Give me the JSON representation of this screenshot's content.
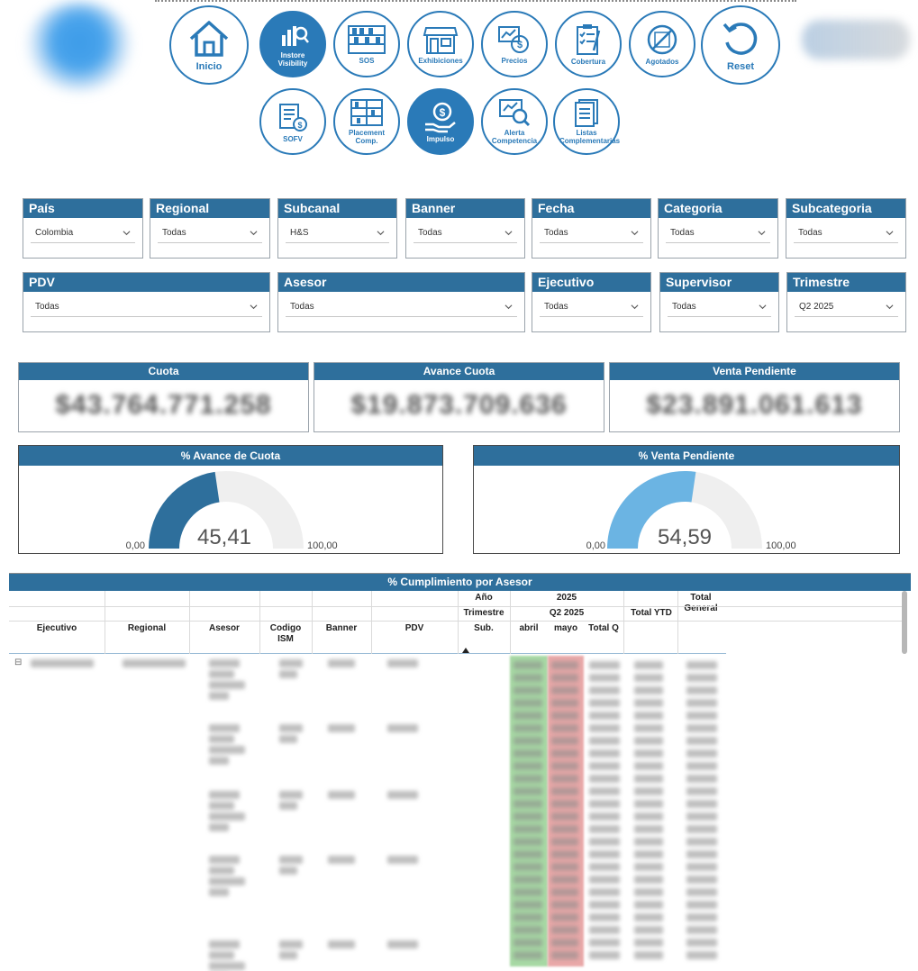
{
  "nav": {
    "row1": [
      {
        "label": "Inicio",
        "icon": "home-icon",
        "active": false
      },
      {
        "label": "Instore Visibility",
        "icon": "analytics-icon",
        "active": true
      },
      {
        "label": "SOS",
        "icon": "shelf-icon",
        "active": false
      },
      {
        "label": "Exhibiciones",
        "icon": "store-icon",
        "active": false
      },
      {
        "label": "Precios",
        "icon": "price-icon",
        "active": false
      },
      {
        "label": "Cobertura",
        "icon": "checklist-icon",
        "active": false
      },
      {
        "label": "Agotados",
        "icon": "out-of-stock-icon",
        "active": false
      },
      {
        "label": "Reset",
        "icon": "reset-icon",
        "active": false
      }
    ],
    "row2": [
      {
        "label": "SOFV",
        "icon": "document-money-icon",
        "active": false
      },
      {
        "label": "Placement Comp.",
        "icon": "shelf-placement-icon",
        "active": false
      },
      {
        "label": "Impulso",
        "icon": "hand-money-icon",
        "active": true
      },
      {
        "label": "Alerta Competencia",
        "icon": "alert-search-icon",
        "active": false
      },
      {
        "label": "Listas Complementarias",
        "icon": "lists-icon",
        "active": false
      }
    ]
  },
  "filters": {
    "pais": {
      "title": "País",
      "value": "Colombia"
    },
    "regional": {
      "title": "Regional",
      "value": "Todas"
    },
    "subcanal": {
      "title": "Subcanal",
      "value": "H&S"
    },
    "banner": {
      "title": "Banner",
      "value": "Todas"
    },
    "fecha": {
      "title": "Fecha",
      "value": "Todas"
    },
    "categoria": {
      "title": "Categoria",
      "value": "Todas"
    },
    "subcategoria": {
      "title": "Subcategoria",
      "value": "Todas"
    },
    "pdv": {
      "title": "PDV",
      "value": "Todas"
    },
    "asesor": {
      "title": "Asesor",
      "value": "Todas"
    },
    "ejecutivo": {
      "title": "Ejecutivo",
      "value": "Todas"
    },
    "supervisor": {
      "title": "Supervisor",
      "value": "Todas"
    },
    "trimestre": {
      "title": "Trimestre",
      "value": "Q2 2025"
    }
  },
  "kpis": {
    "cuota": {
      "title": "Cuota",
      "value": "$43.764.771.258"
    },
    "avance": {
      "title": "Avance Cuota",
      "value": "$19.873.709.636"
    },
    "pendiente": {
      "title": "Venta Pendiente",
      "value": "$23.891.061.613"
    }
  },
  "gauges": {
    "avance": {
      "title": "% Avance de Cuota",
      "value": 45.41,
      "value_label": "45,41",
      "min_label": "0,00",
      "max_label": "100,00",
      "min": 0,
      "max": 100,
      "color": "#2e6f9c"
    },
    "pendiente": {
      "title": "% Venta Pendiente",
      "value": 54.59,
      "value_label": "54,59",
      "min_label": "0,00",
      "max_label": "100,00",
      "min": 0,
      "max": 100,
      "color": "#6bb4e3"
    }
  },
  "table": {
    "title": "% Cumplimiento por Asesor",
    "columns": {
      "ejecutivo": "Ejecutivo",
      "regional": "Regional",
      "asesor": "Asesor",
      "codigo": "Codigo ISM",
      "banner": "Banner",
      "pdv": "PDV",
      "anio": "Año",
      "trimestre": "Trimestre",
      "sub": "Sub.",
      "year": "2025",
      "quarter": "Q2 2025",
      "abril": "abril",
      "mayo": "mayo",
      "totalq": "Total Q",
      "ytd": "Total YTD",
      "general": "Total General"
    },
    "expand_icon": "⊟"
  },
  "colors": {
    "primary": "#2e6f9c",
    "nav_blue": "#2a7ab8",
    "green_cell": "#a7d9a4",
    "red_cell": "#e9a8a8"
  }
}
